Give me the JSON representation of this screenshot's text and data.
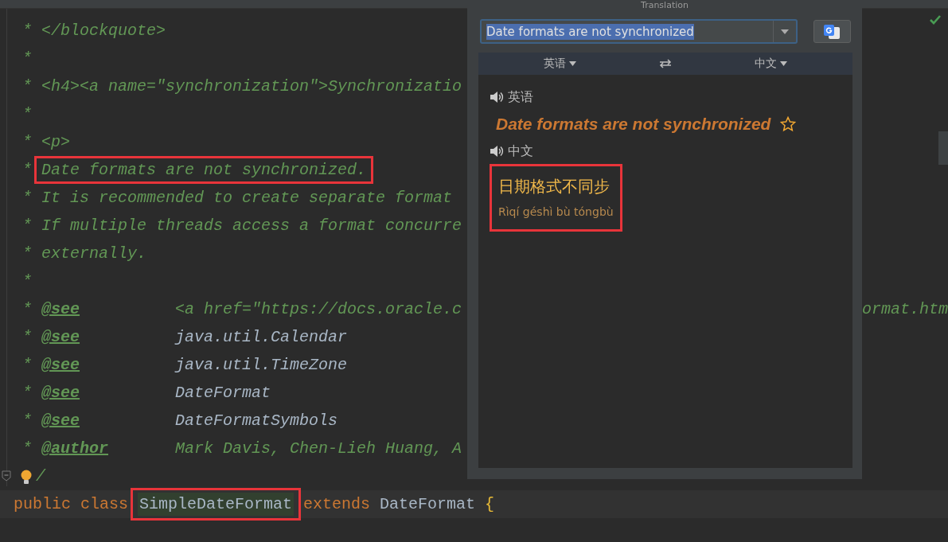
{
  "editor": {
    "lines": [
      {
        "current": false,
        "bulb": false,
        "segments": [
          {
            "kind": "star",
            "text": "*",
            "boxed": false
          },
          {
            "kind": "doc",
            "text": "</blockquote>",
            "boxed": false
          }
        ]
      },
      {
        "current": false,
        "bulb": false,
        "segments": [
          {
            "kind": "star",
            "text": "*",
            "boxed": false
          }
        ]
      },
      {
        "current": false,
        "bulb": false,
        "segments": [
          {
            "kind": "star",
            "text": "*",
            "boxed": false
          },
          {
            "kind": "doc",
            "text": "<h4><a name=\"synchronization\">Synchronizatio",
            "boxed": false
          }
        ]
      },
      {
        "current": false,
        "bulb": false,
        "segments": [
          {
            "kind": "star",
            "text": "*",
            "boxed": false
          }
        ]
      },
      {
        "current": false,
        "bulb": false,
        "segments": [
          {
            "kind": "star",
            "text": "*",
            "boxed": false
          },
          {
            "kind": "doc",
            "text": "<p>",
            "boxed": false
          }
        ]
      },
      {
        "current": false,
        "bulb": false,
        "segments": [
          {
            "kind": "star",
            "text": "*",
            "boxed": false
          },
          {
            "kind": "doc",
            "text": "Date formats are not synchronized.",
            "boxed": true
          }
        ]
      },
      {
        "current": false,
        "bulb": false,
        "segments": [
          {
            "kind": "star",
            "text": "*",
            "boxed": false
          },
          {
            "kind": "doc",
            "text": "It is recommended to create separate format",
            "boxed": false
          }
        ]
      },
      {
        "current": false,
        "bulb": false,
        "segments": [
          {
            "kind": "star",
            "text": "*",
            "boxed": false
          },
          {
            "kind": "doc",
            "text": "If multiple threads access a format concurre",
            "boxed": false
          }
        ]
      },
      {
        "current": false,
        "bulb": false,
        "segments": [
          {
            "kind": "star",
            "text": "*",
            "boxed": false
          },
          {
            "kind": "doc",
            "text": "externally.",
            "boxed": false
          }
        ]
      },
      {
        "current": false,
        "bulb": false,
        "segments": [
          {
            "kind": "star",
            "text": "*",
            "boxed": false
          }
        ]
      },
      {
        "current": false,
        "bulb": false,
        "segments": [
          {
            "kind": "star",
            "text": "*",
            "boxed": false
          },
          {
            "kind": "tag",
            "text": "@see",
            "boxed": false
          },
          {
            "kind": "doc",
            "text": "<a href=\"https://docs.oracle.c",
            "boxed": false
          },
          {
            "kind": "tail",
            "text": "ormat.htm",
            "boxed": false
          }
        ]
      },
      {
        "current": false,
        "bulb": false,
        "segments": [
          {
            "kind": "star",
            "text": "*",
            "boxed": false
          },
          {
            "kind": "tag",
            "text": "@see",
            "boxed": false
          },
          {
            "kind": "ref",
            "text": "java.util.Calendar",
            "boxed": false
          }
        ]
      },
      {
        "current": false,
        "bulb": false,
        "segments": [
          {
            "kind": "star",
            "text": "*",
            "boxed": false
          },
          {
            "kind": "tag",
            "text": "@see",
            "boxed": false
          },
          {
            "kind": "ref",
            "text": "java.util.TimeZone",
            "boxed": false
          }
        ]
      },
      {
        "current": false,
        "bulb": false,
        "segments": [
          {
            "kind": "star",
            "text": "*",
            "boxed": false
          },
          {
            "kind": "tag",
            "text": "@see",
            "boxed": false
          },
          {
            "kind": "ref",
            "text": "DateFormat",
            "boxed": false
          }
        ]
      },
      {
        "current": false,
        "bulb": false,
        "segments": [
          {
            "kind": "star",
            "text": "*",
            "boxed": false
          },
          {
            "kind": "tag",
            "text": "@see",
            "boxed": false
          },
          {
            "kind": "ref",
            "text": "DateFormatSymbols",
            "boxed": false
          }
        ]
      },
      {
        "current": false,
        "bulb": false,
        "segments": [
          {
            "kind": "star",
            "text": "*",
            "boxed": false
          },
          {
            "kind": "tag",
            "text": "@author",
            "boxed": false
          },
          {
            "kind": "doc",
            "text": "Mark Davis, Chen-Lieh Huang, A",
            "boxed": false
          }
        ]
      },
      {
        "current": false,
        "bulb": true,
        "segments": [
          {
            "kind": "doc",
            "text": "/",
            "boxed": false
          }
        ]
      },
      {
        "current": true,
        "bulb": false,
        "segments": [
          {
            "kind": "keyword",
            "text": "public",
            "boxed": false
          },
          {
            "kind": "keyword",
            "text": "class",
            "boxed": false
          },
          {
            "kind": "classname",
            "text": "SimpleDateFormat",
            "boxed": true
          },
          {
            "kind": "keyword",
            "text": "extends",
            "boxed": false
          },
          {
            "kind": "plain",
            "text": "DateFormat",
            "boxed": false
          },
          {
            "kind": "brace",
            "text": "{",
            "boxed": false
          }
        ]
      }
    ]
  },
  "translation_popup": {
    "title": "Translation",
    "query": "Date formats are not synchronized",
    "query_selected": true,
    "source_lang": "英语",
    "target_lang": "中文",
    "source_label": "英语",
    "source_text": "Date formats are not synchronized",
    "favorite": false,
    "target_label": "中文",
    "target_text": "日期格式不同步",
    "pinyin": "Rìqí géshì bù tóngbù",
    "boxed": true
  }
}
